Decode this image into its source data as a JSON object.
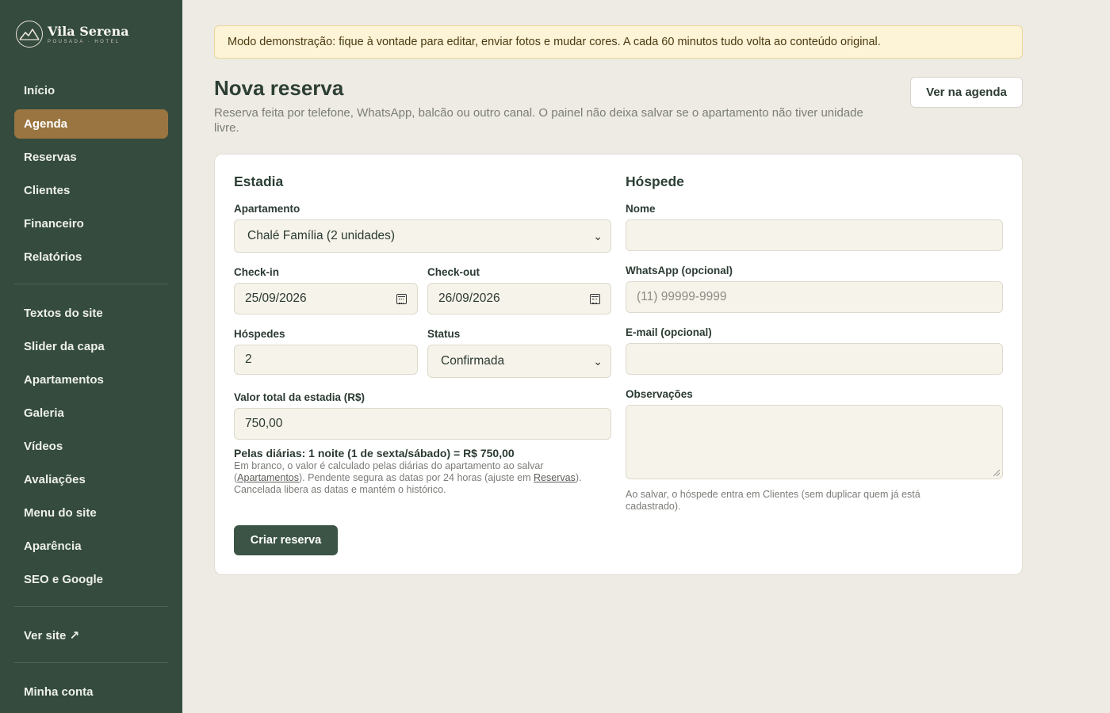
{
  "brand": {
    "name": "Vila Serena",
    "subtitle": "POUSADA · HOTEL",
    "logo_icon": "mountain-logo-icon"
  },
  "sidebar": {
    "primary": [
      {
        "label": "Início",
        "active": false
      },
      {
        "label": "Agenda",
        "active": true
      },
      {
        "label": "Reservas",
        "active": false
      },
      {
        "label": "Clientes",
        "active": false
      },
      {
        "label": "Financeiro",
        "active": false
      },
      {
        "label": "Relatórios",
        "active": false
      }
    ],
    "site": [
      {
        "label": "Textos do site"
      },
      {
        "label": "Slider da capa"
      },
      {
        "label": "Apartamentos"
      },
      {
        "label": "Galeria"
      },
      {
        "label": "Vídeos"
      },
      {
        "label": "Avaliações"
      },
      {
        "label": "Menu do site"
      },
      {
        "label": "Aparência"
      },
      {
        "label": "SEO e Google"
      }
    ],
    "view_site": "Ver site ↗",
    "account": "Minha conta"
  },
  "banner": "Modo demonstração: fique à vontade para editar, enviar fotos e mudar cores. A cada 60 minutos tudo volta ao conteúdo original.",
  "header": {
    "title": "Nova reserva",
    "subtitle": "Reserva feita por telefone, WhatsApp, balcão ou outro canal. O painel não deixa salvar se o apartamento não tiver unidade livre.",
    "agenda_button": "Ver na agenda"
  },
  "stay": {
    "section_title": "Estadia",
    "apartment": {
      "label": "Apartamento",
      "value": "Chalé Família (2 unidades)"
    },
    "checkin": {
      "label": "Check-in",
      "value": "25/09/2026"
    },
    "checkout": {
      "label": "Check-out",
      "value": "26/09/2026"
    },
    "guests": {
      "label": "Hóspedes",
      "value": "2"
    },
    "status": {
      "label": "Status",
      "value": "Confirmada"
    },
    "total": {
      "label": "Valor total da estadia (R$)",
      "value": "750,00"
    },
    "daily_summary": "Pelas diárias: 1 noite (1 de sexta/sábado) = R$ 750,00",
    "hint": {
      "part1": "Em branco, o valor é calculado pelas diárias do apartamento ao salvar (",
      "link1": "Apartamentos",
      "part2": "). Pendente segura as datas por 24 horas (ajuste em ",
      "link2": "Reservas",
      "part3": "). Cancelada libera as datas e mantém o histórico."
    },
    "create_button": "Criar reserva"
  },
  "guest": {
    "section_title": "Hóspede",
    "name": {
      "label": "Nome",
      "value": ""
    },
    "whatsapp": {
      "label": "WhatsApp (opcional)",
      "placeholder": "(11) 99999-9999"
    },
    "email": {
      "label": "E-mail (opcional)",
      "value": ""
    },
    "notes": {
      "label": "Observações",
      "value": ""
    },
    "hint": "Ao salvar, o hóspede entra em Clientes (sem duplicar quem já está cadastrado)."
  },
  "colors": {
    "sidebar": "#344b3e",
    "active": "#9a7541",
    "primary_button": "#3c5446",
    "banner": "#fdf3d6"
  }
}
